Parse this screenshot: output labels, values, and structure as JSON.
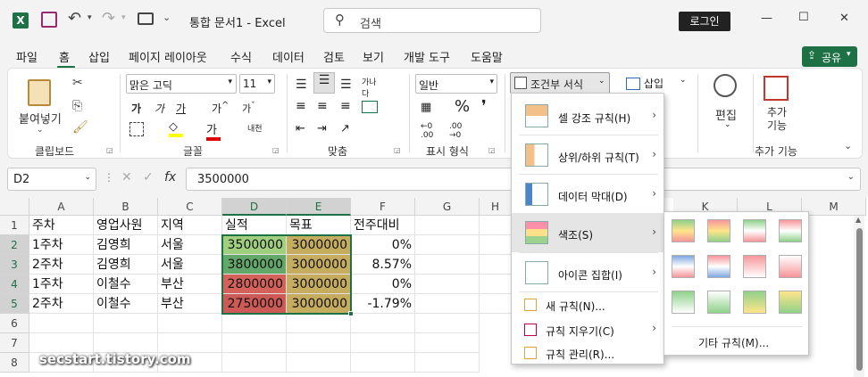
{
  "title_bar": {
    "doc_title": "통합 문서1 - Excel",
    "search_placeholder": "검색",
    "login_label": "로그인",
    "minimize": "—",
    "maximize": "☐",
    "close": "✕"
  },
  "ribbon_tabs": [
    "파일",
    "홈",
    "삽입",
    "페이지 레이아웃",
    "수식",
    "데이터",
    "검토",
    "보기",
    "개발 도구",
    "도움말"
  ],
  "share_label": "공유",
  "ribbon": {
    "clipboard": {
      "paste": "붙여넣기",
      "group": "클립보드"
    },
    "font": {
      "name": "맑은 고딕",
      "size": "11",
      "group": "글꼴",
      "bold": "가",
      "italic": "가",
      "underline": "가"
    },
    "alignment": {
      "group": "맞춤"
    },
    "number": {
      "format": "일반",
      "group": "표시 형식",
      "percent": "%"
    },
    "styles": {
      "conditional": "조건부 서식"
    },
    "cells": {
      "insert": "삽입"
    },
    "editing": {
      "label": "편집"
    },
    "addins": {
      "label": "추가 기능",
      "group": "추가 기능"
    }
  },
  "formula_bar": {
    "name_box": "D2",
    "fx": "fx",
    "value": "3500000"
  },
  "columns": [
    "A",
    "B",
    "C",
    "D",
    "E",
    "F",
    "G",
    "H",
    "I",
    "J",
    "K",
    "L",
    "M"
  ],
  "rows": [
    "1",
    "2",
    "3",
    "4",
    "5",
    "6",
    "7",
    "8"
  ],
  "cells": {
    "header": [
      "주차",
      "영업사원",
      "지역",
      "실적",
      "목표",
      "전주대비"
    ],
    "r2": [
      "1주차",
      "김영희",
      "서울",
      "3500000",
      "3000000",
      "0%"
    ],
    "r3": [
      "2주차",
      "김영희",
      "서울",
      "3800000",
      "3000000",
      "8.57%"
    ],
    "r4": [
      "1주차",
      "이철수",
      "부산",
      "2800000",
      "3000000",
      "0%"
    ],
    "r5": [
      "2주차",
      "이철수",
      "부산",
      "2750000",
      "3000000",
      "-1.79%"
    ]
  },
  "cf_colors": {
    "d2": "#9fcf7f",
    "d3": "#63a86b",
    "d4": "#d4615a",
    "d5": "#cd5a57",
    "e": "#c6ac5e"
  },
  "cf_menu": {
    "highlight": "셀 강조 규칙(H)",
    "topbottom": "상위/하위 규칙(T)",
    "databar": "데이터 막대(D)",
    "colorscale": "색조(S)",
    "iconset": "아이콘 집합(I)",
    "new_rule": "새 규칙(N)...",
    "clear_rules": "규칙 지우기(C)",
    "manage_rules": "규칙 관리(R)..."
  },
  "color_sub": {
    "more_rules": "기타 규칙(M)..."
  },
  "watermark": "secstart.tistory.com"
}
